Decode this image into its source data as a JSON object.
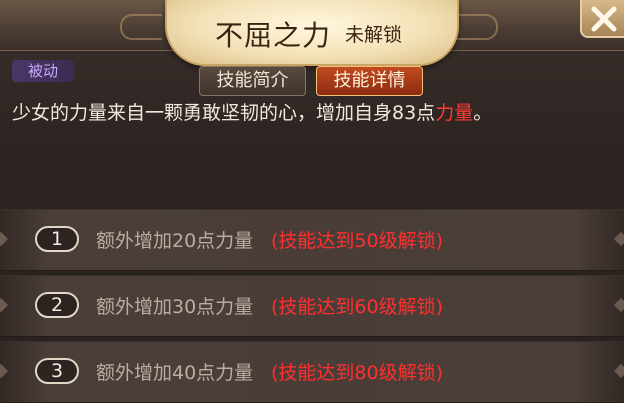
{
  "header": {
    "title": "不屈之力",
    "lock_status": "未解锁"
  },
  "close_icon": "close-x-icon",
  "passive_badge": "被动",
  "tabs": [
    {
      "label": "技能简介",
      "active": false
    },
    {
      "label": "技能详情",
      "active": true
    }
  ],
  "description": {
    "text": "少女的力量来自一颗勇敢坚韧的心，增加自身83点",
    "highlight": "力量",
    "end": "。"
  },
  "unlock_rows": [
    {
      "index": "1",
      "effect": "额外增加20点力量",
      "condition": "(技能达到50级解锁)"
    },
    {
      "index": "2",
      "effect": "额外增加30点力量",
      "condition": "(技能达到60级解锁)"
    },
    {
      "index": "3",
      "effect": "额外增加40点力量",
      "condition": "(技能达到80级解锁)"
    }
  ],
  "colors": {
    "highlight_red": "#ff3b2f",
    "passive_purple": "#c9a7ff",
    "active_tab": "#c24a1f"
  }
}
